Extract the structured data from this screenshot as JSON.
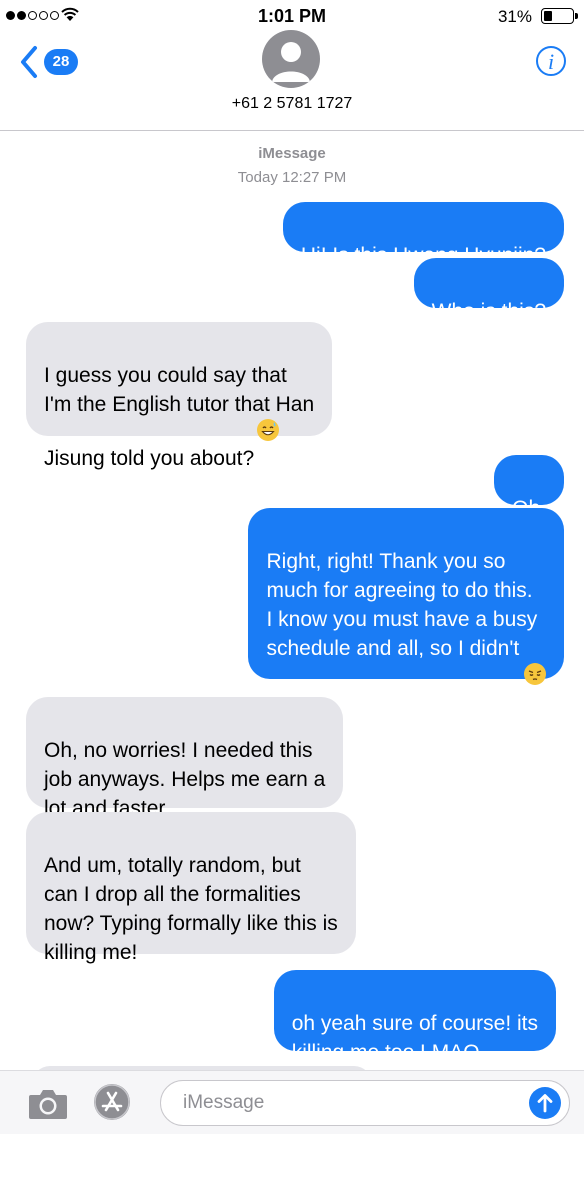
{
  "status_bar": {
    "time": "1:01 PM",
    "battery_percent": "31%",
    "battery_level": 0.31
  },
  "header": {
    "back_badge": "28",
    "contact": "+61 2 5781 1727",
    "info_label": "i"
  },
  "conversation": {
    "service": "iMessage",
    "timestamp": "Today 12:27 PM",
    "messages": [
      {
        "from": "me",
        "text": "Hi! Is this Hwang Hyunjin?"
      },
      {
        "from": "me",
        "text": "Who is this?"
      },
      {
        "from": "them",
        "text": "I guess you could say that\nI'm the English tutor that Han\nJisung told you about?",
        "emoji": "grinning-sweat-face"
      },
      {
        "from": "me",
        "text": "Oh."
      },
      {
        "from": "me",
        "text": "Right, right! Thank you so\nmuch for agreeing to do this.\nI know you must have a busy\nschedule and all, so I didn't\nwant to be a burden to you.",
        "emoji": "pensive-face"
      },
      {
        "from": "them",
        "text": "Oh, no worries! I needed this\njob anyways. Helps me earn a\nlot and faster."
      },
      {
        "from": "them",
        "text": "And um, totally random, but\ncan I drop all the formalities\nnow? Typing formally like this is\nkilling me!"
      },
      {
        "from": "me",
        "text": "oh yeah sure of course! its\nkilling me too LMAO"
      }
    ]
  },
  "input_bar": {
    "placeholder": "iMessage",
    "icons": [
      "camera-icon",
      "app-store-icon",
      "send-arrow-icon"
    ]
  },
  "colors": {
    "sent_bubble": "#1a7cf5",
    "received_bubble": "#e5e5ea",
    "accent": "#1a7cf5",
    "meta_text": "#8e8e93"
  }
}
